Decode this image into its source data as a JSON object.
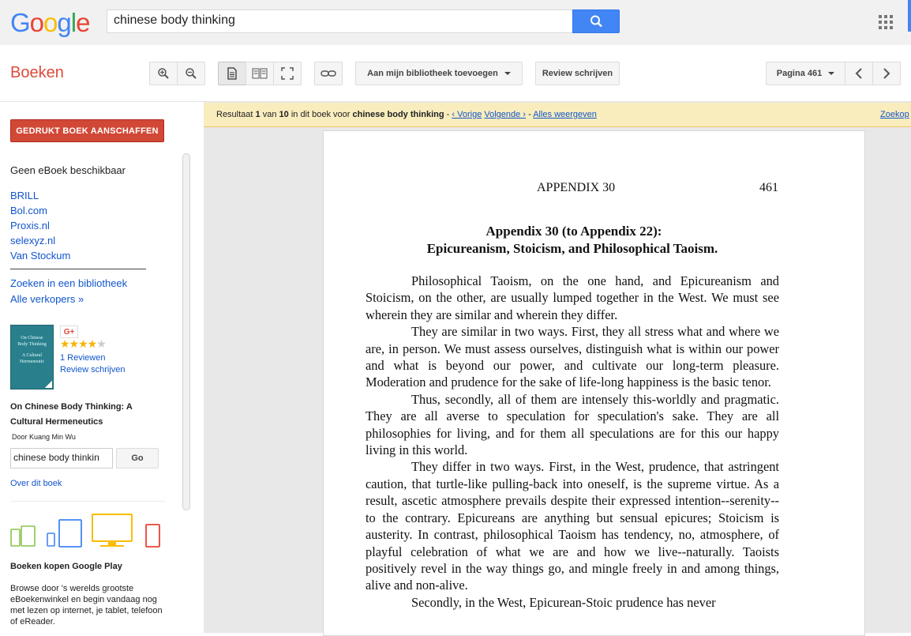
{
  "search": {
    "query": "chinese body thinking",
    "logo": [
      "G",
      "o",
      "o",
      "g",
      "l",
      "e"
    ]
  },
  "toolbar": {
    "brand": "Boeken",
    "add_library": "Aan mijn bibliotheek toevoegen",
    "write_review": "Review schrijven",
    "page_select": "Pagina 461"
  },
  "sidebar": {
    "buy_button": "GEDRUKT BOEK AANSCHAFFEN",
    "no_ebook": "Geen eBoek beschikbaar",
    "sellers": [
      "BRILL",
      "Bol.com",
      "Proxis.nl",
      "selexyz.nl",
      "Van Stockum"
    ],
    "find_library": "Zoeken in een bibliotheek",
    "all_sellers": "Alle verkopers »",
    "gplus": "G+",
    "rating_stars": 4,
    "reviews_count": "1 Reviewen",
    "write_review": "Review schrijven",
    "cover_text": [
      "On Chinese",
      "Body Thinking",
      "A Cultural",
      "Hermeneutic"
    ],
    "book_title": "On Chinese Body Thinking: A Cultural Hermeneutics",
    "author": "Door Kuang Min Wu",
    "inbook_query": "chinese body thinkin",
    "go_button": "Go",
    "about_book": "Over dit boek",
    "play_title": "Boeken kopen Google Play",
    "play_desc": "Browse door 's werelds grootste eBoekenwinkel en begin vandaag nog met lezen op internet, je tablet, telefoon of eReader."
  },
  "result_bar": {
    "prefix": "Resultaat ",
    "index": "1",
    "of": " van ",
    "total": "10",
    "in_book_for": " in dit boek voor ",
    "query": "chinese body thinking",
    "sep1": " - ",
    "prev": "‹ Vorige",
    "next": "Volgende ›",
    "sep2": " - ",
    "show_all": "Alles weergeven",
    "search_more": "Zoekop"
  },
  "page": {
    "running_head": "APPENDIX 30",
    "number": "461",
    "title_line1": "Appendix 30 (to Appendix 22):",
    "title_line2": "Epicureanism, Stoicism, and Philosophical Taoism.",
    "paragraphs": [
      "Philosophical Taoism, on the one hand, and Epicureanism and Stoicism, on the other, are usually lumped together in the West. We must see wherein they are similar and wherein they differ.",
      "They are similar in two ways. First, they all stress what and where we are, in person. We must assess ourselves, distinguish what is within our power and what is beyond our power, and cultivate our long-term pleasure. Moderation and prudence for the sake of life-long happiness is the basic tenor.",
      "Thus, secondly, all of them are intensely this-worldly and pragmatic. They are all averse to speculation for speculation's sake. They are all philosophies for living, and for them all speculations are for this our happy living in this world.",
      "They differ in two ways. First, in the West, prudence, that astringent caution, that turtle-like pulling-back into oneself, is the supreme virtue. As a result, ascetic atmosphere prevails despite their expressed intention--serenity--to the contrary. Epicureans are anything but sensual epicures; Stoicism is austerity. In contrast, philosophical Taoism has tendency, no, atmosphere, of playful celebration of what we are and how we live--naturally. Taoists positively revel in the way things go, and mingle freely in and among things, alive and non-alive.",
      "Secondly, in the West, Epicurean-Stoic prudence has never"
    ]
  }
}
